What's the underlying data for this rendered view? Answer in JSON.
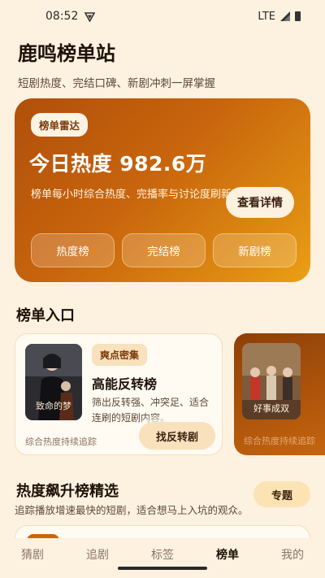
{
  "status_bar": {
    "time": "08:52",
    "network": "LTE",
    "icons": [
      "vpn-shield-icon",
      "signal-icon",
      "battery-icon"
    ]
  },
  "header": {
    "title": "鹿鸣榜单站",
    "subtitle": "短剧热度、完结口碑、新剧冲刺一屏掌握"
  },
  "hero": {
    "badge": "榜单雷达",
    "title": "今日热度 982.6万",
    "desc": "榜单每小时综合热度、完播率与讨论度刷新",
    "detail_button": "查看详情",
    "tabs": [
      "热度榜",
      "完结榜",
      "新剧榜"
    ],
    "colors": {
      "gradient_start": "#b04f0b",
      "gradient_end": "#eba017"
    }
  },
  "entry_section": {
    "title": "榜单入口",
    "cards": [
      {
        "tag": "爽点密集",
        "name": "高能反转榜",
        "desc": "筛出反转强、冲突足、适合连刷的短剧内容。",
        "footer": "综合热度持续追踪",
        "button": "找反转剧",
        "poster_title": "致命的梦"
      },
      {
        "footer": "综合热度持续追踪",
        "poster_title": "好事成双"
      }
    ]
  },
  "rising_section": {
    "title": "热度飙升榜精选",
    "desc": "追踪播放增速最快的短剧，适合想马上入坑的观众。",
    "topic_button": "专题"
  },
  "bottom_nav": {
    "items": [
      "猜剧",
      "追剧",
      "标签",
      "榜单",
      "我的"
    ],
    "active": "榜单"
  }
}
